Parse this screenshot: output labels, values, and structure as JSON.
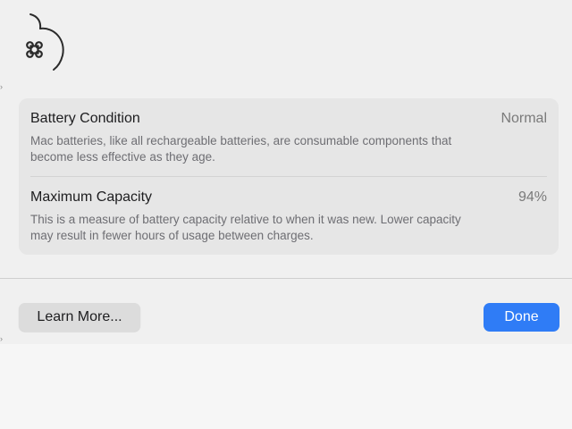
{
  "colors": {
    "accent": "#2f7cf6",
    "sheet_background": "#f0f0f0",
    "card_background": "#e6e6e6"
  },
  "header": {
    "icon": "battery-app-icon"
  },
  "battery_info": {
    "condition": {
      "title": "Battery Condition",
      "value": "Normal",
      "description": "Mac batteries, like all rechargeable batteries, are consumable components that become less effective as they age."
    },
    "capacity": {
      "title": "Maximum Capacity",
      "value": "94%",
      "description": "This is a measure of battery capacity relative to when it was new. Lower capacity may result in fewer hours of usage between charges."
    }
  },
  "footer": {
    "learn_more_label": "Learn More...",
    "done_label": "Done"
  }
}
